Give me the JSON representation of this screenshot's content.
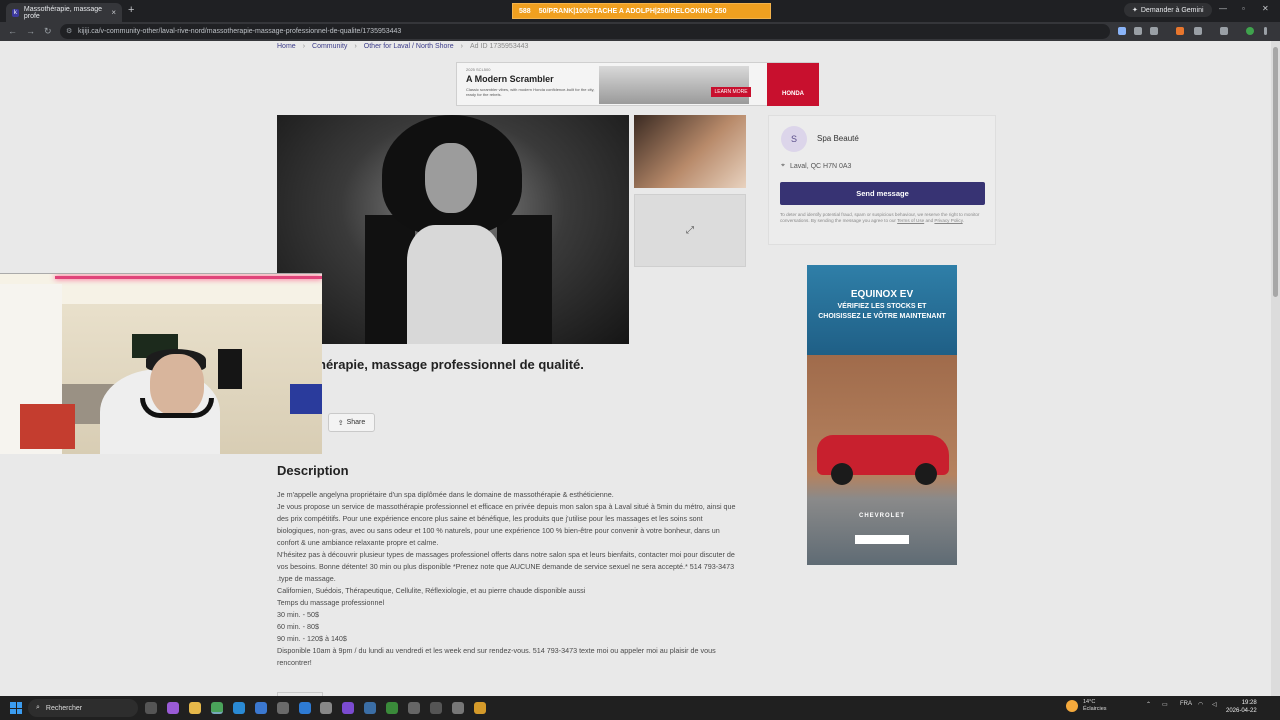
{
  "browser": {
    "tab_title": "Massothérapie, massage profe",
    "tab_close": "×",
    "new_tab": "+",
    "banner_left": "588",
    "banner_text": "50/PRANK|100/STACHE A ADOLPH|250/RELOOKING 250",
    "gemini_label": "Demander à Gemini",
    "url": "kijiji.ca/v-community-other/laval-rive-nord/massotherapie-massage-professionnel-de-qualite/1735953443"
  },
  "breadcrumb": {
    "home": "Home",
    "community": "Community",
    "other": "Other for Laval / North Shore",
    "ad_id": "Ad ID 1735953443",
    "separator": "›"
  },
  "top_ad": {
    "small": "2025 SCL500",
    "headline": "A Modern Scrambler",
    "sub": "Classic scrambler vibes, with modern Honda confidence-built for the city, ready for the rebels.",
    "cta": "LEARN MORE",
    "brand": "HONDA"
  },
  "seller": {
    "avatar_letter": "S",
    "name": "Spa Beauté",
    "location": "Laval, QC H7N 0A3",
    "send_button": "Send message",
    "disclaimer_pre": "To deter and identify potential fraud, spam or suspicious behaviour, we reserve the right to monitor conversations. By sending the message you agree to our ",
    "terms": "Terms of Use",
    "and": " and ",
    "privacy": "Privacy Policy",
    "period": "."
  },
  "side_ad": {
    "title": "EQUINOX EV",
    "text": "VÉRIFIEZ LES STOCKS ET CHOISISSEZ LE VÔTRE MAINTENANT",
    "brand": "CHEVROLET"
  },
  "listing": {
    "title": "Massothérapie, massage professionnel de qualité.",
    "title_visible": "hérapie, massage professionnel de qualité.",
    "share": "Share",
    "description_heading": "Description",
    "description_lines": [
      "Je m'appelle angelyna propriétaire d'un spa diplômée dans le domaine de massothérapie & esthéticienne.",
      "Je vous propose un service de massothérapie professionnel et efficace en privée depuis mon salon spa à Laval situé à 5min du métro, ainsi que des prix compétitifs. Pour une expérience encore plus saine et bénéfique, les produits que j'utilise pour les massages et les soins sont biologiques, non-gras, avec ou sans odeur et 100 % naturels, pour une expérience 100 % bien-être pour convenir à votre bonheur, dans un confort & une ambiance relaxante propre et calme.",
      "N'hésitez pas à découvrir plusieur types de massages professionel offerts dans notre salon spa et leurs bienfaits, contacter moi pour discuter de vos besoins. Bonne détente! 30 min ou plus disponible *Prenez note que AUCUNE demande de service sexuel ne sera accepté.* 514 793-3473",
      ".type de massage.",
      "Californien, Suédois, Thérapeutique, Cellulite, Réflexiologie, et au pierre chaude disponible aussi",
      "Temps du massage professionnel",
      "30 min. - 50$",
      "60 min. - 80$",
      "90 min. - 120$ à 140$",
      "Disponible 10am à 9pm / du lundi au vendredi et les week end sur rendez-vous. 514 793-3473 texte moi ou appeler moi au plaisir de vous rencontrer!"
    ]
  },
  "taskbar": {
    "search": "Rechercher",
    "weather_temp": "14°C",
    "weather_desc": "Éclaircies",
    "lang": "FRA",
    "time": "19:28",
    "date": "2026-04-22"
  },
  "colors": {
    "kijiji_purple": "#373373",
    "honda_red": "#c8102e",
    "banner_orange": "#f0a020"
  }
}
